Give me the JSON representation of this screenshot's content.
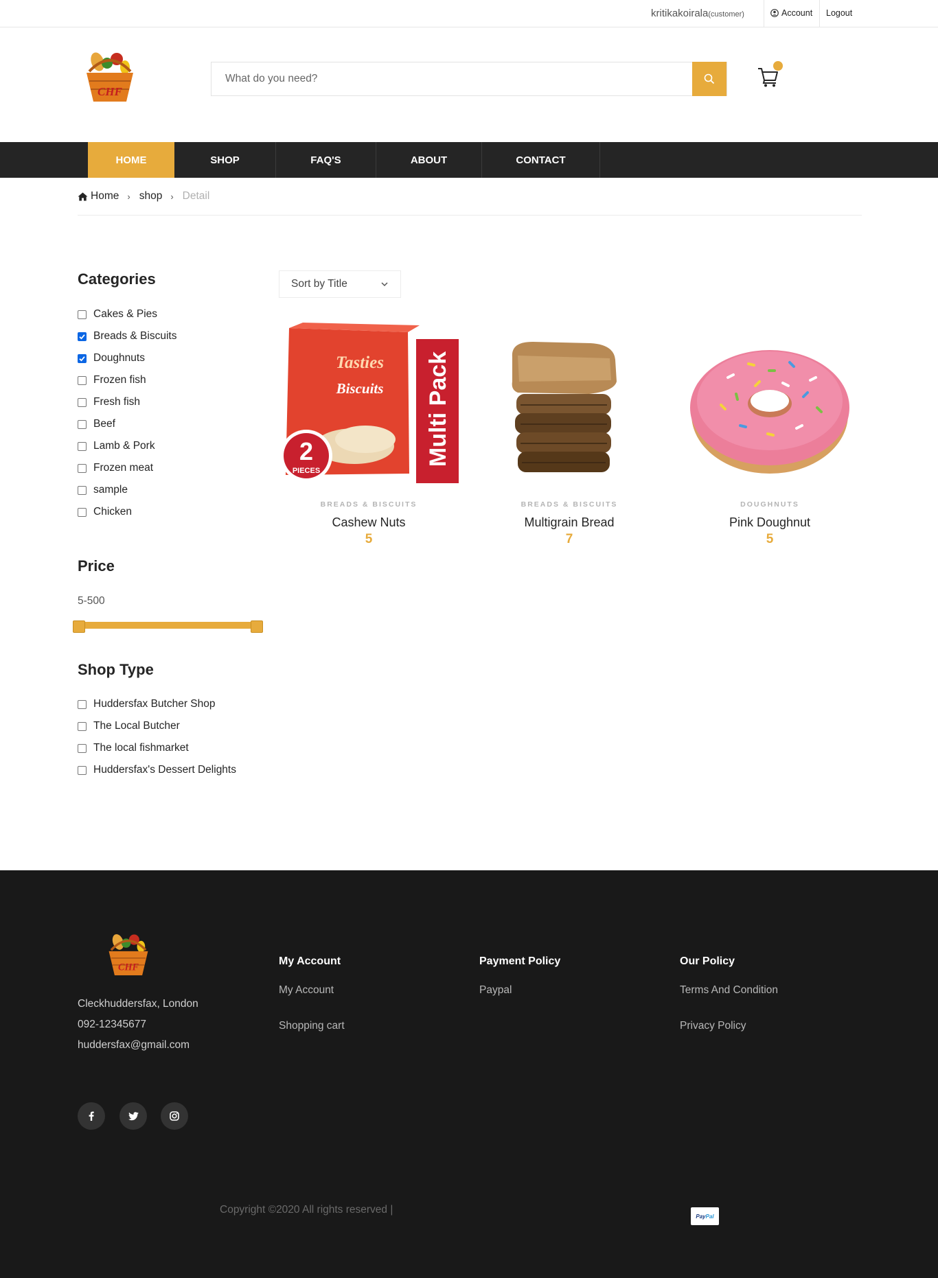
{
  "topbar": {
    "username": "kritikakoirala",
    "role": "(customer)",
    "account": "Account",
    "logout": "Logout"
  },
  "header": {
    "logo_text": "CHF",
    "search_placeholder": "What do you need?"
  },
  "nav": {
    "items": [
      "HOME",
      "SHOP",
      "FAQ'S",
      "ABOUT",
      "CONTACT"
    ],
    "active": "HOME"
  },
  "breadcrumb": {
    "home": "Home",
    "shop": "shop",
    "current": "Detail"
  },
  "sidebar": {
    "categories_title": "Categories",
    "categories": [
      {
        "label": "Cakes & Pies",
        "checked": false
      },
      {
        "label": "Breads & Biscuits",
        "checked": true
      },
      {
        "label": "Doughnuts",
        "checked": true
      },
      {
        "label": "Frozen fish",
        "checked": false
      },
      {
        "label": "Fresh fish",
        "checked": false
      },
      {
        "label": "Beef",
        "checked": false
      },
      {
        "label": "Lamb & Pork",
        "checked": false
      },
      {
        "label": "Frozen meat",
        "checked": false
      },
      {
        "label": "sample",
        "checked": false
      },
      {
        "label": "Chicken",
        "checked": false
      }
    ],
    "price_title": "Price",
    "price_range": "5-500",
    "shop_type_title": "Shop Type",
    "shop_types": [
      {
        "label": "Huddersfax Butcher Shop",
        "checked": false
      },
      {
        "label": "The Local Butcher",
        "checked": false
      },
      {
        "label": "The local fishmarket",
        "checked": false
      },
      {
        "label": "Huddersfax's Dessert Delights",
        "checked": false
      }
    ]
  },
  "sort": {
    "selected": "Sort by Title"
  },
  "products": [
    {
      "category": "BREADS & BISCUITS",
      "name": "Cashew Nuts",
      "price": "5",
      "image": {
        "brand": "Tasties",
        "product": "Biscuits",
        "badge_number": "2",
        "badge_text": "PIECES",
        "side_text": "Multi Pack"
      }
    },
    {
      "category": "BREADS & BISCUITS",
      "name": "Multigrain Bread",
      "price": "7"
    },
    {
      "category": "DOUGHNUTS",
      "name": "Pink Doughnut",
      "price": "5"
    }
  ],
  "footer": {
    "logo_text": "CHF",
    "address": "Cleckhuddersfax, London",
    "phone": "092-12345677",
    "email": "huddersfax@gmail.com",
    "my_account": {
      "title": "My Account",
      "links": [
        "My Account",
        "Shopping cart"
      ]
    },
    "payment_policy": {
      "title": "Payment Policy",
      "links": [
        "Paypal"
      ]
    },
    "our_policy": {
      "title": "Our Policy",
      "links": [
        "Terms And Condition",
        "Privacy Policy"
      ]
    },
    "social": [
      "facebook-icon",
      "twitter-icon",
      "instagram-icon"
    ],
    "copyright": "Copyright ©2020 All rights reserved |",
    "paypal_badge": {
      "part1": "Pay",
      "part2": "Pal"
    }
  },
  "colors": {
    "accent": "#e7ab3c",
    "nav_bg": "#252525",
    "footer_bg": "#191919",
    "checkbox_on": "#0b66e4"
  }
}
